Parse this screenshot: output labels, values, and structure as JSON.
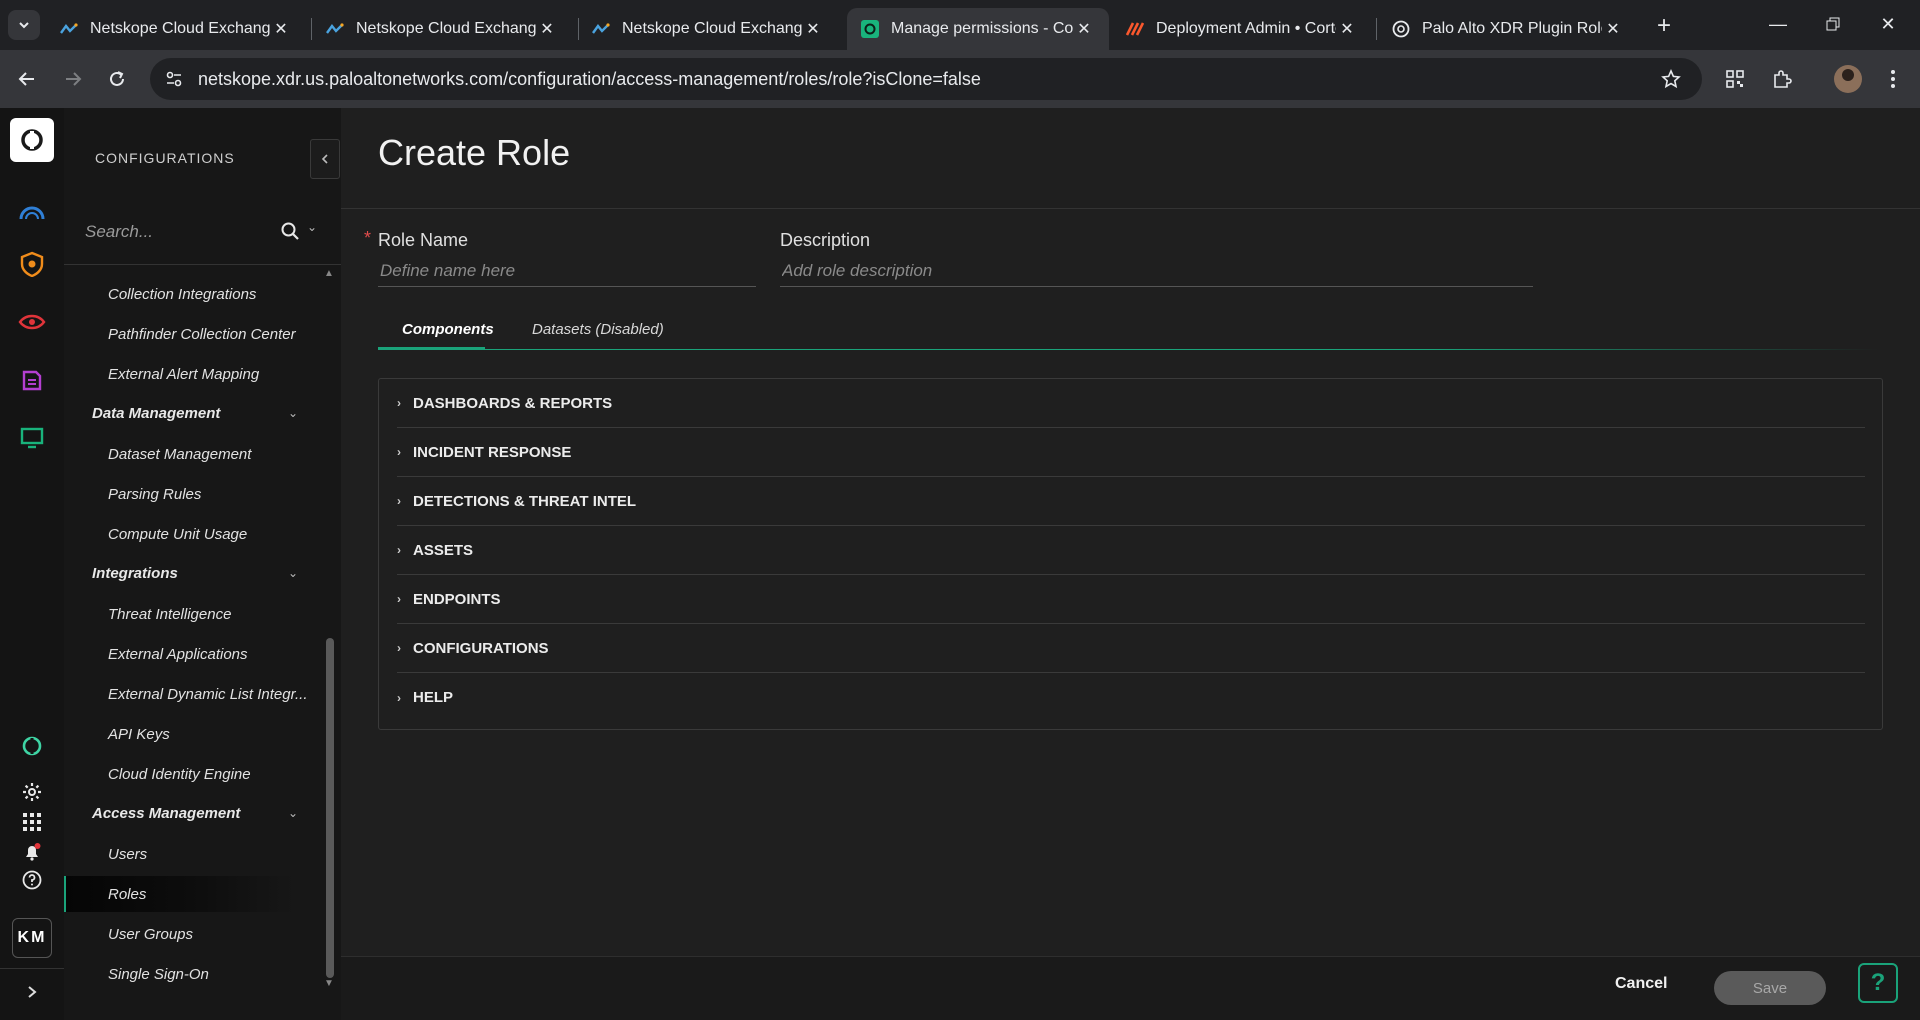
{
  "browser": {
    "tabs": [
      {
        "title": "Netskope Cloud Exchange",
        "icon": "netskope-icon",
        "active": false
      },
      {
        "title": "Netskope Cloud Exchange",
        "icon": "netskope-icon",
        "active": false
      },
      {
        "title": "Netskope Cloud Exchange",
        "icon": "netskope-icon",
        "active": false
      },
      {
        "title": "Manage permissions - Cort",
        "icon": "cortex-icon",
        "active": true
      },
      {
        "title": "Deployment Admin • Corte",
        "icon": "paloalto-icon",
        "active": false
      },
      {
        "title": "Palo Alto XDR Plugin Roles",
        "icon": "openai-icon",
        "active": false
      }
    ],
    "url": "netskope.xdr.us.paloaltonetworks.com/configuration/access-management/roles/role?isClone=false"
  },
  "sidebar": {
    "header": "CONFIGURATIONS",
    "search_placeholder": "Search...",
    "items": [
      {
        "label": "Collection Integrations",
        "type": "item"
      },
      {
        "label": "Pathfinder Collection Center",
        "type": "item"
      },
      {
        "label": "External Alert Mapping",
        "type": "item"
      },
      {
        "label": "Data Management",
        "type": "group"
      },
      {
        "label": "Dataset Management",
        "type": "item"
      },
      {
        "label": "Parsing Rules",
        "type": "item"
      },
      {
        "label": "Compute Unit Usage",
        "type": "item"
      },
      {
        "label": "Integrations",
        "type": "group"
      },
      {
        "label": "Threat Intelligence",
        "type": "item"
      },
      {
        "label": "External Applications",
        "type": "item"
      },
      {
        "label": "External Dynamic List Integr...",
        "type": "item"
      },
      {
        "label": "API Keys",
        "type": "item"
      },
      {
        "label": "Cloud Identity Engine",
        "type": "item"
      },
      {
        "label": "Access Management",
        "type": "group"
      },
      {
        "label": "Users",
        "type": "item"
      },
      {
        "label": "Roles",
        "type": "item",
        "selected": true
      },
      {
        "label": "User Groups",
        "type": "item"
      },
      {
        "label": "Single Sign-On",
        "type": "item"
      }
    ]
  },
  "rail": {
    "user_initials": "KM"
  },
  "main": {
    "title": "Create Role",
    "role_name_label": "Role Name",
    "role_name_placeholder": "Define name here",
    "description_label": "Description",
    "description_placeholder": "Add role description",
    "tabs": [
      {
        "label": "Components",
        "active": true
      },
      {
        "label": "Datasets (Disabled)",
        "active": false
      }
    ],
    "sections": [
      "DASHBOARDS & REPORTS",
      "INCIDENT RESPONSE",
      "DETECTIONS & THREAT INTEL",
      "ASSETS",
      "ENDPOINTS",
      "CONFIGURATIONS",
      "HELP"
    ],
    "cancel_label": "Cancel",
    "save_label": "Save"
  },
  "colors": {
    "accent": "#1aa37a",
    "background": "#1f1f1f",
    "required": "#e24c4c"
  }
}
